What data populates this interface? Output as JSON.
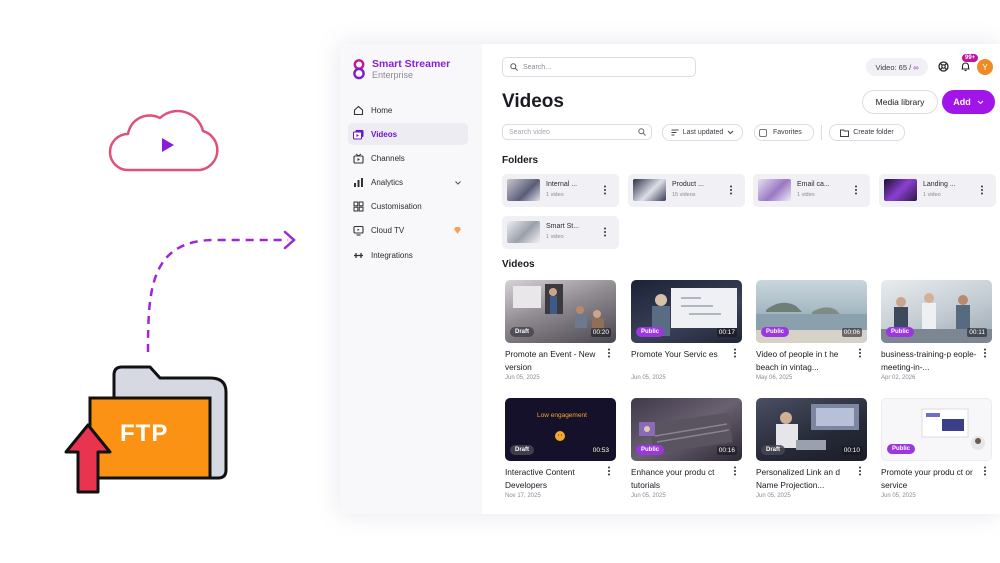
{
  "illustration": {
    "ftp_label": "FTP",
    "colors": {
      "cloud": "#e0517a",
      "play": "#8a1dd8",
      "arrow": "#a324d6",
      "folder": "#fb9214",
      "upload": "#e8344e"
    }
  },
  "brand": {
    "name": "Smart Streamer",
    "sub": "Enterprise"
  },
  "sidebar": {
    "items": [
      {
        "label": "Home",
        "icon": "home-icon"
      },
      {
        "label": "Videos",
        "icon": "videos-icon",
        "active": true
      },
      {
        "label": "Channels",
        "icon": "channels-icon"
      },
      {
        "label": "Analytics",
        "icon": "analytics-icon"
      },
      {
        "label": "Customisation",
        "icon": "customisation-icon"
      },
      {
        "label": "Cloud TV",
        "icon": "cloud-tv-icon"
      },
      {
        "label": "Integrations",
        "icon": "integrations-icon"
      }
    ]
  },
  "header": {
    "search_placeholder": "Search...",
    "video_quota_label": "Video: 65 /",
    "video_quota_limit": "∞",
    "notification_count": "99+",
    "avatar_initial": "Y"
  },
  "page": {
    "title": "Videos",
    "media_library": "Media library",
    "add": "Add",
    "search_videos_placeholder": "Search video",
    "sort_label": "Last updated",
    "favorites_label": "Favorites",
    "create_folder": "Create folder"
  },
  "folders_label": "Folders",
  "folders": [
    {
      "name": "Internal ...",
      "count": "1 video"
    },
    {
      "name": "Product ...",
      "count": "15 videos"
    },
    {
      "name": "Email ca...",
      "count": "1 video"
    },
    {
      "name": "Landing ...",
      "count": "1 video"
    },
    {
      "name": "Smart St...",
      "count": "1 video"
    }
  ],
  "videos_label": "Videos",
  "videos": [
    {
      "title": "Promote an Event - New version",
      "date": "Jun 05, 2025",
      "status": "Draft",
      "duration": "00:20"
    },
    {
      "title": "Promote Your Servic es",
      "date": "Jun 05, 2025",
      "status": "Public",
      "duration": "00:17"
    },
    {
      "title": "Video of people in t he beach in vintag...",
      "date": "May 06, 2025",
      "status": "Public",
      "duration": "00:06"
    },
    {
      "title": "business-training-p eople-meeting-in-...",
      "date": "Apr 02, 2026",
      "status": "Public",
      "duration": "00:11"
    },
    {
      "title": "Interactive Content Developers",
      "date": "Nov 17, 2025",
      "status": "Draft",
      "duration": "00:53",
      "thumb_text": "Low engagement"
    },
    {
      "title": "Enhance your produ ct tutorials",
      "date": "Jun 05, 2025",
      "status": "Public",
      "duration": "00:16"
    },
    {
      "title": "Personalized Link an d Name Projection...",
      "date": "Jun 05, 2025",
      "status": "Draft",
      "duration": "00:10"
    },
    {
      "title": "Promote your produ ct or service",
      "date": "Jun 05, 2025",
      "status": "Public",
      "duration": ""
    }
  ]
}
